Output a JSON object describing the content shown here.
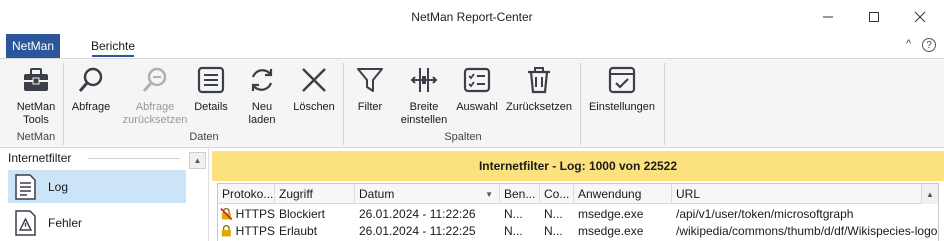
{
  "window": {
    "title": "NetMan Report-Center",
    "minimize_icon": "minimize-icon",
    "maximize_icon": "maximize-icon",
    "close_icon": "close-icon"
  },
  "ribbon_tabs": {
    "file_tab": "NetMan",
    "active_tab": "Berichte",
    "help_glyph": "?",
    "collapse_glyph": "^"
  },
  "ribbon": {
    "buttons": [
      {
        "label_1": "NetMan",
        "label_2": "Tools",
        "icon": "toolbox-icon",
        "enabled": true
      },
      {
        "label_1": "Abfrage",
        "label_2": "",
        "icon": "search-icon",
        "enabled": true
      },
      {
        "label_1": "Abfrage",
        "label_2": "zurücksetzen",
        "icon": "search-reset-icon",
        "enabled": false
      },
      {
        "label_1": "Details",
        "label_2": "",
        "icon": "details-list-icon",
        "enabled": true
      },
      {
        "label_1": "Neu",
        "label_2": "laden",
        "icon": "refresh-icon",
        "enabled": true
      },
      {
        "label_1": "Löschen",
        "label_2": "",
        "icon": "delete-x-icon",
        "enabled": true
      },
      {
        "label_1": "Filter",
        "label_2": "",
        "icon": "filter-funnel-icon",
        "enabled": true
      },
      {
        "label_1": "Breite",
        "label_2": "einstellen",
        "icon": "column-width-icon",
        "enabled": true
      },
      {
        "label_1": "Auswahl",
        "label_2": "",
        "icon": "checklist-icon",
        "enabled": true
      },
      {
        "label_1": "Zurücksetzen",
        "label_2": "",
        "icon": "trash-can-icon",
        "enabled": true
      },
      {
        "label_1": "Einstellungen",
        "label_2": "",
        "icon": "settings-check-icon",
        "enabled": true
      }
    ],
    "groups": [
      "NetMan",
      "Daten",
      "Spalten"
    ]
  },
  "sidebar": {
    "header": "Internetfilter",
    "items": [
      {
        "label": "Log",
        "icon": "log-document-icon",
        "selected": true
      },
      {
        "label": "Fehler",
        "icon": "warning-document-icon",
        "selected": false
      }
    ]
  },
  "banner": {
    "text": "Internetfilter - Log: 1000 von 22522",
    "color": "#fbe27f"
  },
  "table": {
    "columns": [
      "Protoko...",
      "Zugriff",
      "Datum",
      "Ben...",
      "Co...",
      "Anwendung",
      "URL"
    ],
    "rows": [
      {
        "protocol": "HTTPS",
        "access": "Blockiert",
        "date": "26.01.2024 - 11:22:26",
        "user": "N...",
        "computer": "N...",
        "app": "msedge.exe",
        "url": "/api/v1/user/token/microsoftgraph",
        "lock_icon": "lock-blocked-icon"
      },
      {
        "protocol": "HTTPS",
        "access": "Erlaubt",
        "date": "26.01.2024 - 11:22:25",
        "user": "N...",
        "computer": "N...",
        "app": "msedge.exe",
        "url": "/wikipedia/commons/thumb/d/df/Wikispecies-logo...",
        "lock_icon": "lock-icon"
      }
    ]
  },
  "colors": {
    "accent": "#2b579a",
    "selection": "#cce4f7"
  }
}
